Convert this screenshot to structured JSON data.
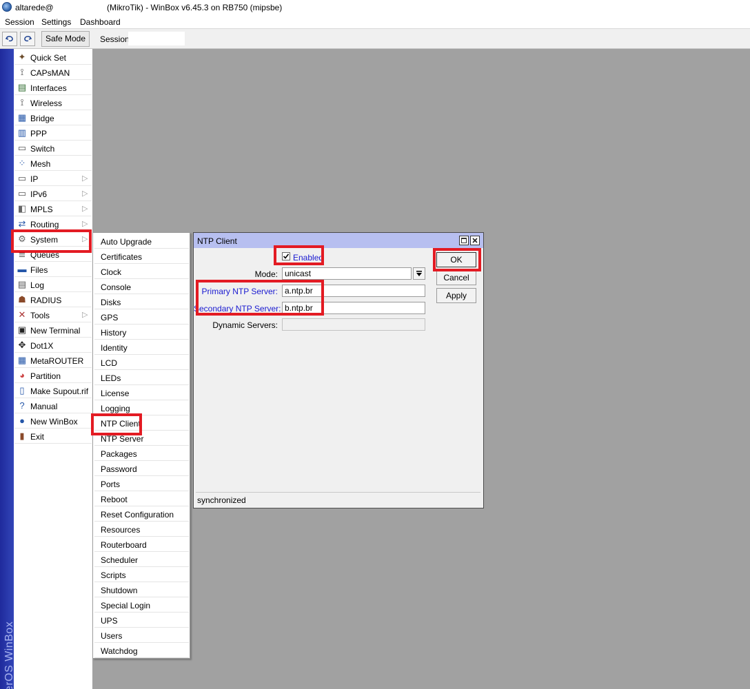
{
  "window": {
    "user": "altarede@",
    "title": "(MikroTik) - WinBox v6.45.3 on RB750 (mipsbe)"
  },
  "menu": [
    "Session",
    "Settings",
    "Dashboard"
  ],
  "toolbar": {
    "safe_mode": "Safe Mode",
    "session_label": "Session:",
    "session_value": ""
  },
  "side_brand": "RouterOS WinBox",
  "sidebar": [
    {
      "label": "Quick Set",
      "icon": "wand-icon"
    },
    {
      "label": "CAPsMAN",
      "icon": "antenna-icon"
    },
    {
      "label": "Interfaces",
      "icon": "interfaces-icon"
    },
    {
      "label": "Wireless",
      "icon": "wireless-icon"
    },
    {
      "label": "Bridge",
      "icon": "bridge-icon"
    },
    {
      "label": "PPP",
      "icon": "ppp-icon"
    },
    {
      "label": "Switch",
      "icon": "switch-icon"
    },
    {
      "label": "Mesh",
      "icon": "mesh-icon"
    },
    {
      "label": "IP",
      "icon": "ip-icon",
      "submenu": true
    },
    {
      "label": "IPv6",
      "icon": "ipv6-icon",
      "submenu": true
    },
    {
      "label": "MPLS",
      "icon": "mpls-icon",
      "submenu": true
    },
    {
      "label": "Routing",
      "icon": "routing-icon",
      "submenu": true
    },
    {
      "label": "System",
      "icon": "gear-icon",
      "submenu": true
    },
    {
      "label": "Queues",
      "icon": "queues-icon"
    },
    {
      "label": "Files",
      "icon": "folder-icon"
    },
    {
      "label": "Log",
      "icon": "log-icon"
    },
    {
      "label": "RADIUS",
      "icon": "radius-icon"
    },
    {
      "label": "Tools",
      "icon": "tools-icon",
      "submenu": true
    },
    {
      "label": "New Terminal",
      "icon": "terminal-icon"
    },
    {
      "label": "Dot1X",
      "icon": "dot1x-icon"
    },
    {
      "label": "MetaROUTER",
      "icon": "metarouter-icon"
    },
    {
      "label": "Partition",
      "icon": "partition-icon"
    },
    {
      "label": "Make Supout.rif",
      "icon": "file-icon"
    },
    {
      "label": "Manual",
      "icon": "help-icon"
    },
    {
      "label": "New WinBox",
      "icon": "globe-icon"
    },
    {
      "label": "Exit",
      "icon": "exit-icon"
    }
  ],
  "submenu": [
    "Auto Upgrade",
    "Certificates",
    "Clock",
    "Console",
    "Disks",
    "GPS",
    "History",
    "Identity",
    "LCD",
    "LEDs",
    "License",
    "Logging",
    "NTP Client",
    "NTP Server",
    "Packages",
    "Password",
    "Ports",
    "Reboot",
    "Reset Configuration",
    "Resources",
    "Routerboard",
    "Scheduler",
    "Scripts",
    "Shutdown",
    "Special Login",
    "UPS",
    "Users",
    "Watchdog"
  ],
  "dialog": {
    "title": "NTP Client",
    "enabled_label": "Enabled",
    "enabled": true,
    "mode_label": "Mode:",
    "mode_value": "unicast",
    "primary_label": "Primary NTP Server:",
    "primary_value": "a.ntp.br",
    "secondary_label": "Secondary NTP Server:",
    "secondary_value": "b.ntp.br",
    "dynamic_label": "Dynamic Servers:",
    "dynamic_value": "",
    "ok": "OK",
    "cancel": "Cancel",
    "apply": "Apply",
    "status": "synchronized"
  },
  "colors": {
    "highlight": "#e31b23",
    "workspace": "#a1a1a1",
    "dialog_title": "#b7bff0",
    "brand_strip": "#2a3aae",
    "label_blue": "#1a1ad0"
  }
}
